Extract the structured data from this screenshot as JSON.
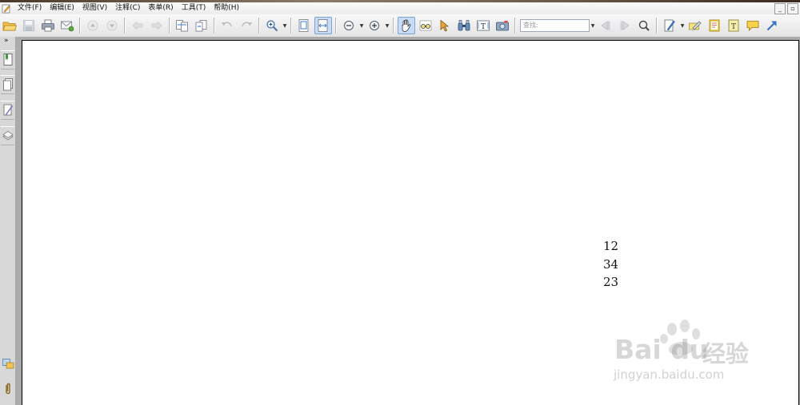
{
  "menu": {
    "items": [
      "文件(F)",
      "编辑(E)",
      "视图(V)",
      "注释(C)",
      "表单(R)",
      "工具(T)",
      "帮助(H)"
    ],
    "window_controls": [
      "_",
      "▫"
    ]
  },
  "toolbar": {
    "search_placeholder": "查找:"
  },
  "document": {
    "lines": [
      "12",
      "34",
      "23"
    ]
  },
  "watermark": {
    "brand": "Bai du",
    "cn": "经验",
    "url": "jingyan.baidu.com"
  },
  "icons": {
    "app": "edit-app-icon",
    "open": "folder-open-icon",
    "save": "save-icon",
    "print": "printer-icon",
    "email": "email-icon",
    "hand": "hand-tool-icon"
  },
  "colors": {
    "active_tool": "#C9DCF5",
    "doc_background": "#ABABAB",
    "page": "#FFFFFF"
  }
}
